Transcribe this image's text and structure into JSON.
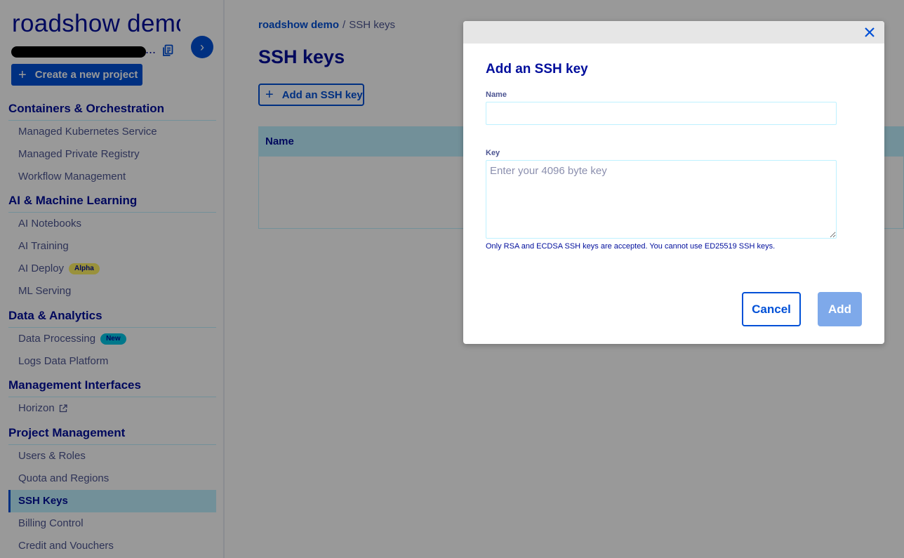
{
  "sidebar": {
    "project_title": "roadshow demo",
    "project_id_ellipsis": "...",
    "create_button": "Create a new project",
    "sections": [
      {
        "title": "Containers & Orchestration",
        "items": [
          {
            "label": "Managed Kubernetes Service"
          },
          {
            "label": "Managed Private Registry"
          },
          {
            "label": "Workflow Management"
          }
        ]
      },
      {
        "title": "AI & Machine Learning",
        "items": [
          {
            "label": "AI Notebooks"
          },
          {
            "label": "AI Training"
          },
          {
            "label": "AI Deploy",
            "badge": "Alpha"
          },
          {
            "label": "ML Serving"
          }
        ]
      },
      {
        "title": "Data & Analytics",
        "items": [
          {
            "label": "Data Processing",
            "badge": "New"
          },
          {
            "label": "Logs Data Platform"
          }
        ]
      },
      {
        "title": "Management Interfaces",
        "items": [
          {
            "label": "Horizon"
          }
        ]
      },
      {
        "title": "Project Management",
        "items": [
          {
            "label": "Users & Roles"
          },
          {
            "label": "Quota and Regions"
          },
          {
            "label": "SSH Keys"
          },
          {
            "label": "Billing Control"
          },
          {
            "label": "Credit and Vouchers"
          }
        ]
      }
    ]
  },
  "main": {
    "breadcrumb": {
      "link": "roadshow demo",
      "separator": "/",
      "current": "SSH keys"
    },
    "title": "SSH keys",
    "add_button": "Add an SSH key",
    "table_header_name": "Name"
  },
  "modal": {
    "title": "Add an SSH key",
    "name_label": "Name",
    "name_value": "",
    "key_label": "Key",
    "key_placeholder": "Enter your 4096 byte key",
    "help_text": "Only RSA and ECDSA SSH keys are accepted. You cannot use ED25519 SSH keys.",
    "cancel_button": "Cancel",
    "add_button": "Add"
  },
  "colors": {
    "primary": "#0050d7",
    "heading": "#000e9c",
    "active_bg": "#bef1ff",
    "disabled_button": "#7ea9ea"
  },
  "icons": [
    "copy-icon",
    "chevron-right-icon",
    "plus-icon",
    "external-link-icon",
    "close-icon"
  ]
}
